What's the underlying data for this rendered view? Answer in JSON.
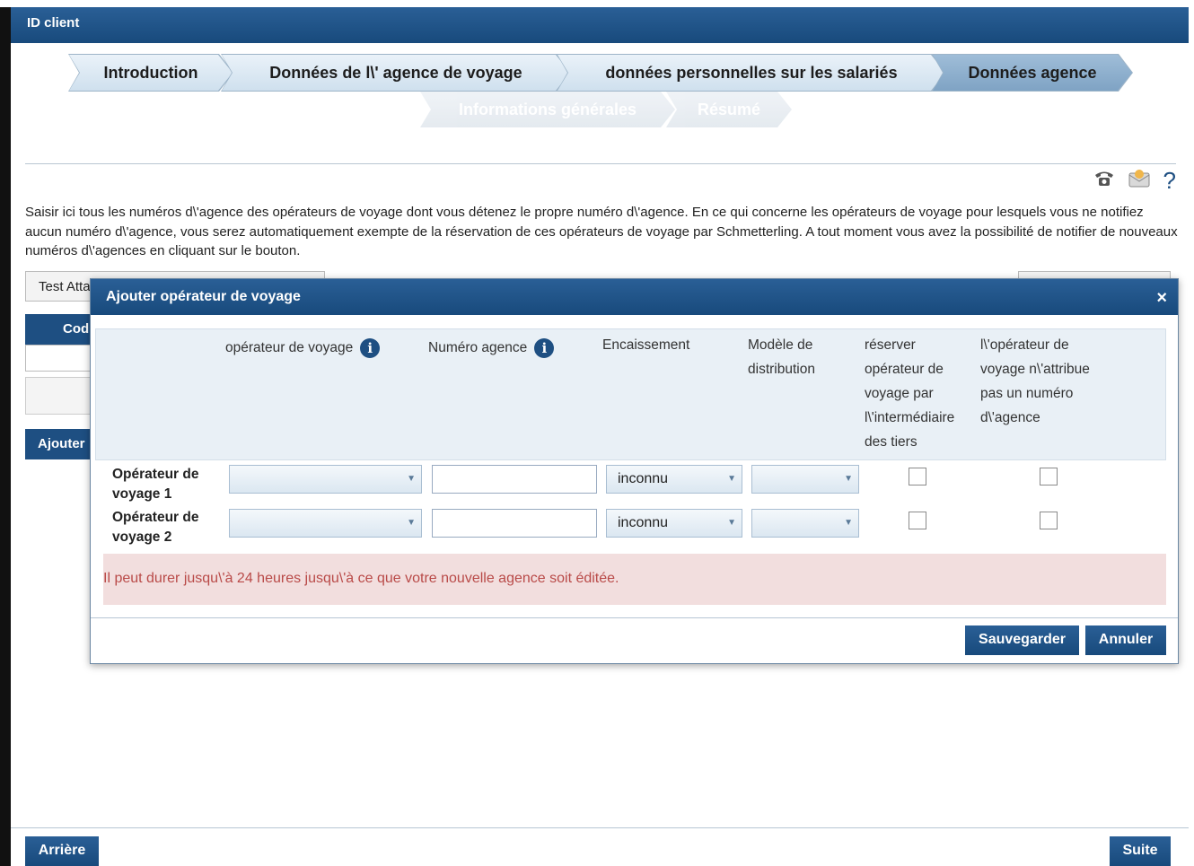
{
  "window": {
    "title": "ID client"
  },
  "steps": [
    {
      "label": "Introduction",
      "state": "done"
    },
    {
      "label": "Données de l\\' agence de voyage",
      "state": "done"
    },
    {
      "label": "données personnelles sur les salariés",
      "state": "done"
    },
    {
      "label": "Données agence",
      "state": "active"
    },
    {
      "label": "Informations générales",
      "state": "upcoming"
    },
    {
      "label": "Résumé",
      "state": "upcoming"
    }
  ],
  "toolbar": {
    "phone_icon": "phone-icon",
    "mail_icon": "mail-icon",
    "help_icon": "help-icon",
    "help_label": "?"
  },
  "intro": {
    "text": "Saisir ici tous les numéros d\\'agence des opérateurs de voyage dont vous détenez le propre numéro d\\'agence. En ce qui concerne les opérateurs de voyage pour lesquels vous ne notifiez aucun numéro d\\'agence, vous serez automatiquement exempte de la réservation de ces opérateurs de voyage par Schmetterling. A tout moment vous avez la possibilité de notifier de nouveaux numéros d\\'agences en cliquant sur le bouton."
  },
  "background": {
    "input_value": "Test Atta",
    "column_header": "Cod",
    "add_button": "Ajouter"
  },
  "dialog": {
    "title": "Ajouter opérateur de voyage",
    "close_label": "×",
    "columns": {
      "operator": "opérateur de voyage",
      "agency_number": "Numéro agence",
      "collection": "Encaissement",
      "distribution": "Modèle de distribution",
      "third_party": "réserver opérateur de voyage par l\\'intermédiaire des tiers",
      "no_number": "l\\'opérateur de voyage n\\'attribue pas un numéro d\\'agence"
    },
    "rows": [
      {
        "label": "Opérateur de voyage 1",
        "operator": "",
        "agency_number": "",
        "collection": "inconnu",
        "distribution": "",
        "third_party": false,
        "no_number": false
      },
      {
        "label": "Opérateur de voyage 2",
        "operator": "",
        "agency_number": "",
        "collection": "inconnu",
        "distribution": "",
        "third_party": false,
        "no_number": false
      }
    ],
    "warning": "Il peut durer jusqu\\'à 24 heures jusqu\\'à ce que votre nouvelle agence soit éditée.",
    "save_label": "Sauvegarder",
    "cancel_label": "Annuler"
  },
  "footer": {
    "back_label": "Arrière",
    "next_label": "Suite"
  },
  "colors": {
    "primary": "#1e4f82",
    "header_band": "#e9f0f6",
    "warning_bg": "#f2dede",
    "warning_text": "#b94a48"
  }
}
